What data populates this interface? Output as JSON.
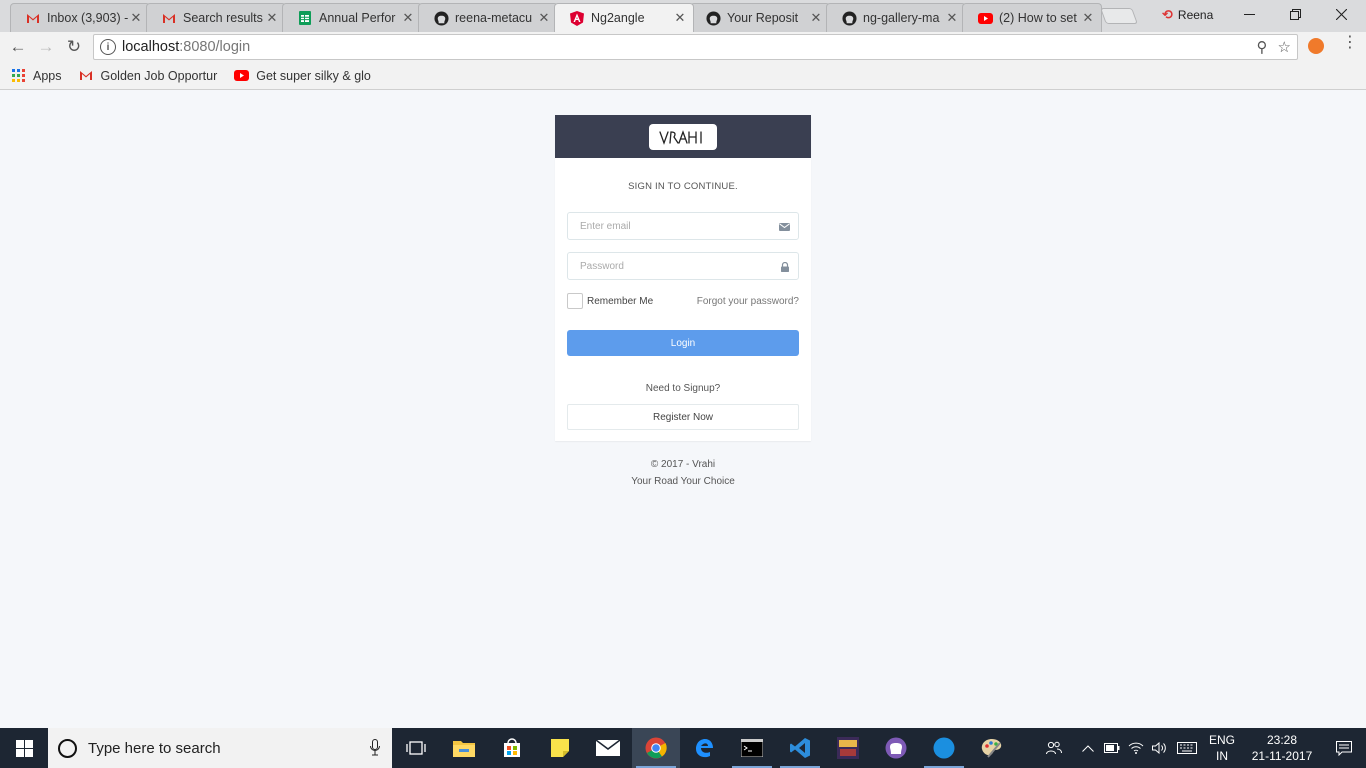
{
  "browser": {
    "tabs": [
      {
        "title": "Inbox (3,903) -",
        "icon": "gmail-icon"
      },
      {
        "title": "Search results",
        "icon": "gmail-icon"
      },
      {
        "title": "Annual Perfor",
        "icon": "sheets-icon"
      },
      {
        "title": "reena-metacu",
        "icon": "github-icon"
      },
      {
        "title": "Ng2angle",
        "icon": "angular-icon"
      },
      {
        "title": "Your Reposit",
        "icon": "github-icon"
      },
      {
        "title": "ng-gallery-ma",
        "icon": "github-icon"
      },
      {
        "title": "(2) How to set",
        "icon": "youtube-icon"
      }
    ],
    "active_tab_index": 4,
    "profile_name": "Reena",
    "url_host": "localhost",
    "url_rest": ":8080/login",
    "bookmarks": [
      {
        "label": "Apps",
        "icon": "apps-grid-icon"
      },
      {
        "label": "Golden Job Opportur",
        "icon": "gmail-icon"
      },
      {
        "label": "Get super silky & glo",
        "icon": "youtube-icon"
      }
    ]
  },
  "login": {
    "logo_text": "VRAHI",
    "subtitle": "SIGN IN TO CONTINUE.",
    "email_placeholder": "Enter email",
    "password_placeholder": "Password",
    "remember_label": "Remember Me",
    "forgot_label": "Forgot your password?",
    "login_button": "Login",
    "signup_prompt": "Need to Signup?",
    "register_button": "Register Now",
    "footer_copyright": "© 2017 - Vrahi",
    "footer_tagline": "Your Road Your Choice"
  },
  "colors": {
    "header_bg": "#3a3f51",
    "login_button": "#5d9cec",
    "page_bg": "#f5f7fa",
    "taskbar_bg": "#1d2633"
  },
  "taskbar": {
    "search_placeholder": "Type here to search",
    "lang_top": "ENG",
    "lang_bottom": "IN",
    "time": "23:28",
    "date": "21-11-2017"
  }
}
